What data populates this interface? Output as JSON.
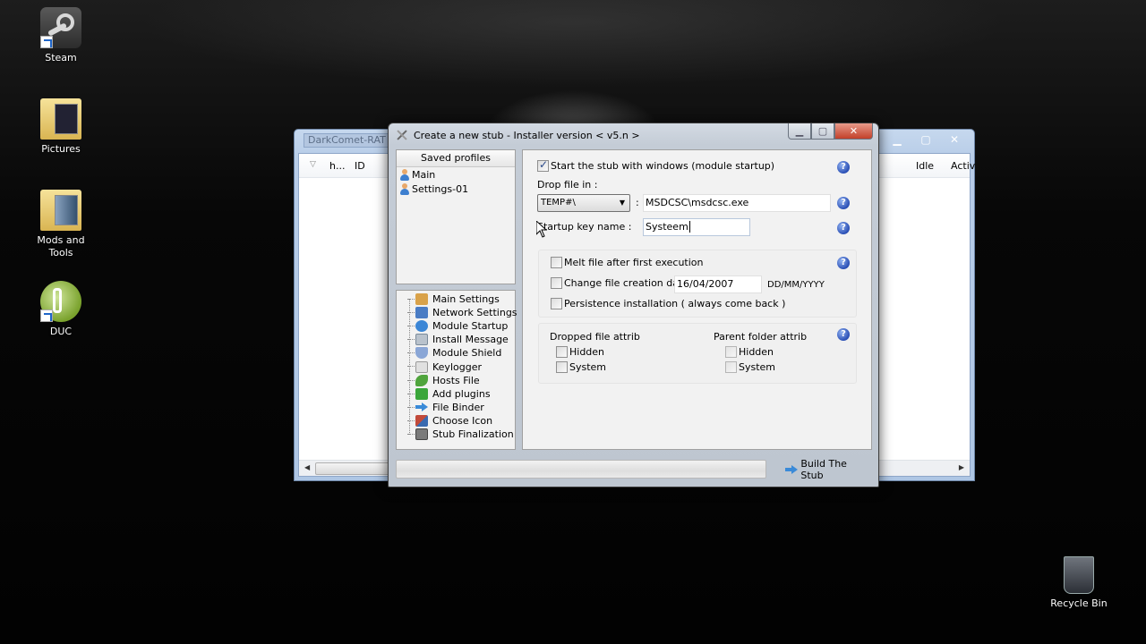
{
  "desktop": {
    "icons": [
      {
        "label": "Steam"
      },
      {
        "label": "Pictures"
      },
      {
        "label": "Mods and Tools"
      },
      {
        "label": "DUC"
      },
      {
        "label": "Recycle Bin"
      }
    ]
  },
  "background_window": {
    "title": "DarkComet-RAT",
    "columns": [
      "h...",
      "ID",
      "Idle",
      "Activ"
    ]
  },
  "dialog": {
    "title": "Create a new stub - Installer version < v5.n >",
    "saved_profiles": {
      "header": "Saved profiles",
      "items": [
        "Main",
        "Settings-01"
      ]
    },
    "nav": {
      "items": [
        {
          "label": "Main Settings",
          "icon": "house-icon",
          "color": "#d9a24a"
        },
        {
          "label": "Network Settings",
          "icon": "computer-icon",
          "color": "#4a7cc4"
        },
        {
          "label": "Module Startup",
          "icon": "startup-icon",
          "color": "#3b86d6"
        },
        {
          "label": "Install Message",
          "icon": "message-icon",
          "color": "#b9c2cc"
        },
        {
          "label": "Module Shield",
          "icon": "shield-icon",
          "color": "#8aa6d6"
        },
        {
          "label": "Keylogger",
          "icon": "keyboard-icon",
          "color": "#d0d0d0"
        },
        {
          "label": "Hosts File",
          "icon": "leaf-icon",
          "color": "#4fa43c"
        },
        {
          "label": "Add plugins",
          "icon": "puzzle-icon",
          "color": "#3aa63a"
        },
        {
          "label": "File Binder",
          "icon": "binder-arrow-icon",
          "color": "#3a8ad8"
        },
        {
          "label": "Choose Icon",
          "icon": "image-icon",
          "color": "#c24a3a"
        },
        {
          "label": "Stub Finalization",
          "icon": "finalize-icon",
          "color": "#7a7a7a"
        }
      ]
    },
    "settings": {
      "start_with_windows": {
        "label": "Start the stub with windows (module startup)",
        "checked": true
      },
      "drop_file_label": "Drop file in :",
      "drop_location": "TEMP#\\",
      "colon": ":",
      "drop_path": "MSDCSC\\msdcsc.exe",
      "startup_key_label": "Startup key name :",
      "startup_key_value": "Systeem",
      "melt_file": {
        "label": "Melt file after first execution",
        "checked": false
      },
      "change_date": {
        "label": "Change file creation date :",
        "checked": false,
        "value": "16/04/2007",
        "format": "DD/MM/YYYY"
      },
      "persistence": {
        "label": "Persistence installation ( always come back )",
        "checked": false
      },
      "dropped_attrib": {
        "title": "Dropped file attrib",
        "hidden": "Hidden",
        "system": "System"
      },
      "parent_attrib": {
        "title": "Parent folder attrib",
        "hidden": "Hidden",
        "system": "System"
      },
      "help_glyph": "?"
    },
    "build_button": "Build The Stub",
    "progress": 0
  }
}
